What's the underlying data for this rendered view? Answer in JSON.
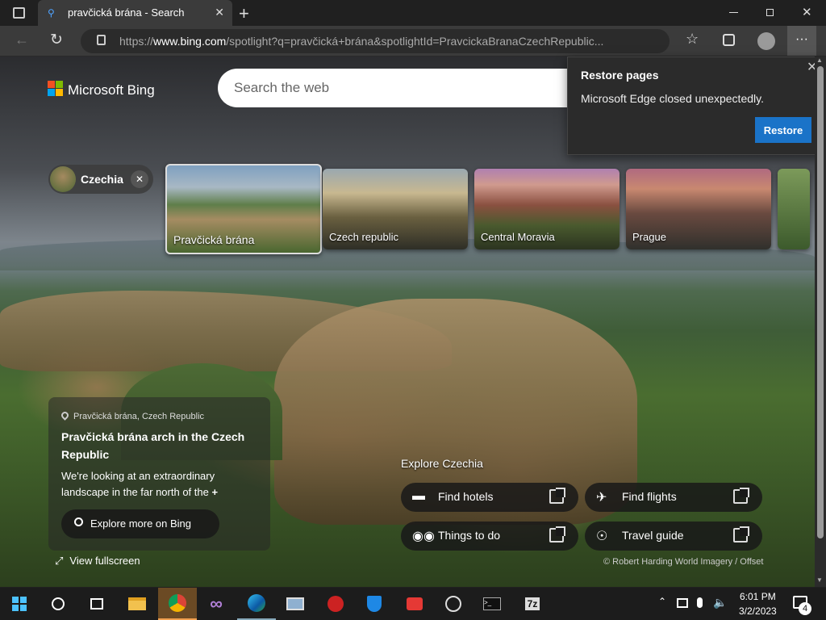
{
  "tab": {
    "title": "pravčická brána - Search"
  },
  "address": {
    "url_prefix": "https://",
    "url_host": "www.bing.com",
    "url_rest": "/spotlight?q=pravčická+brána&spotlightId=PravcickaBranaCzechRepublic..."
  },
  "bing": {
    "logo_text": "Microsoft Bing",
    "search_placeholder": "Search the web"
  },
  "popup": {
    "title": "Restore pages",
    "message": "Microsoft Edge closed unexpectedly.",
    "restore_label": "Restore"
  },
  "chip": {
    "label": "Czechia"
  },
  "cards": [
    {
      "label": "Pravčická brána"
    },
    {
      "label": "Czech republic"
    },
    {
      "label": "Central Moravia"
    },
    {
      "label": "Prague"
    }
  ],
  "info": {
    "location": "Pravčická brána, Czech Republic",
    "headline": "Pravčická brána arch in the Czech Republic",
    "description": "We're looking at an extraordinary landscape in the far north of the",
    "more_glyph": "+",
    "explore_label": "Explore more on Bing",
    "fullscreen_label": "View fullscreen"
  },
  "explore": {
    "title": "Explore Czechia",
    "links": [
      {
        "label": "Find hotels",
        "icon": "bed-icon"
      },
      {
        "label": "Find flights",
        "icon": "plane-icon"
      },
      {
        "label": "Things to do",
        "icon": "binoculars-icon"
      },
      {
        "label": "Travel guide",
        "icon": "compass-icon"
      }
    ]
  },
  "copyright": "© Robert Harding World Imagery / Offset",
  "taskbar": {
    "time": "6:01 PM",
    "date": "3/2/2023",
    "notification_count": "4"
  },
  "colors": {
    "accent": "#1a73c8",
    "taskbar": "#1c1c1c",
    "chrome_bg": "#202020"
  }
}
